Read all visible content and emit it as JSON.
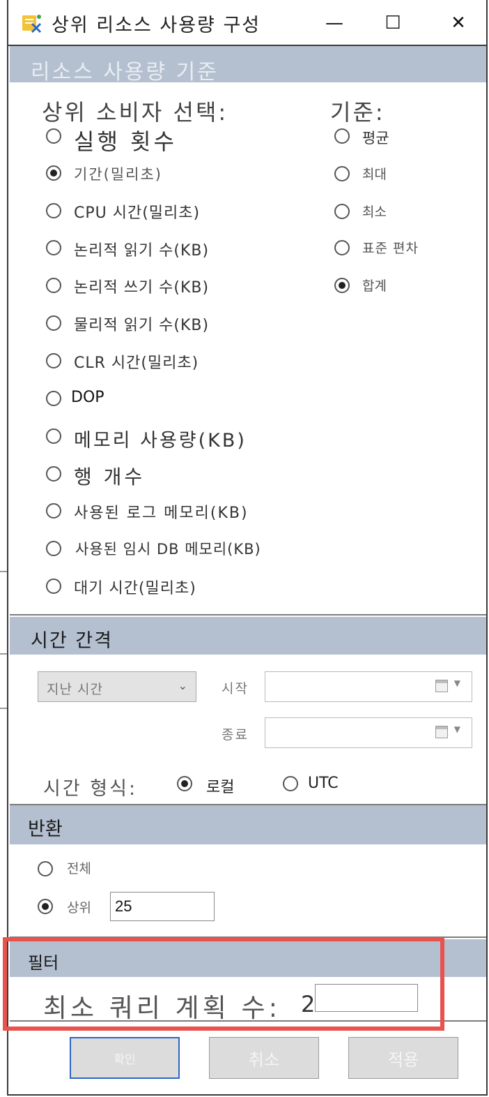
{
  "window": {
    "title": "상위 리소스 사용량 구성",
    "controls": {
      "minimize": "—",
      "maximize": "☐",
      "close": "✕"
    }
  },
  "resource_section": {
    "header": "리소스 사용량 기준",
    "consumer_label": "상위 소비자 선택:",
    "basis_label": "기준:",
    "consumers": [
      {
        "label": "실행 횟수",
        "checked": false
      },
      {
        "label": "기간(밀리초)",
        "checked": true
      },
      {
        "label": "CPU 시간(밀리초)",
        "checked": false
      },
      {
        "label": "논리적 읽기 수(KB)",
        "checked": false
      },
      {
        "label": "논리적 쓰기 수(KB)",
        "checked": false
      },
      {
        "label": "물리적 읽기 수(KB)",
        "checked": false
      },
      {
        "label": "CLR 시간(밀리초)",
        "checked": false
      },
      {
        "label": "DOP",
        "checked": false
      },
      {
        "label": "메모리 사용량(KB)",
        "checked": false
      },
      {
        "label": "행 개수",
        "checked": false
      },
      {
        "label": "사용된 로그 메모리(KB)",
        "checked": false
      },
      {
        "label": "사용된 임시 DB 메모리(KB)",
        "checked": false
      },
      {
        "label": "대기 시간(밀리초)",
        "checked": false
      }
    ],
    "basis": [
      {
        "label": "평균",
        "checked": false
      },
      {
        "label": "최대",
        "checked": false
      },
      {
        "label": "최소",
        "checked": false
      },
      {
        "label": "표준 편차",
        "checked": false
      },
      {
        "label": "합계",
        "checked": true
      }
    ]
  },
  "time_section": {
    "header": "시간 간격",
    "range_select": "지난 시간",
    "start_label": "시작",
    "end_label": "종료",
    "start_value": "",
    "end_value": "",
    "format_label": "시간 형식:",
    "formats": [
      {
        "label": "로컬",
        "checked": true
      },
      {
        "label": "UTC",
        "checked": false
      }
    ]
  },
  "return_section": {
    "header": "반환",
    "options": [
      {
        "label": "전체",
        "checked": false
      },
      {
        "label": "상위",
        "checked": true
      }
    ],
    "top_value": "25"
  },
  "filter_section": {
    "header": "필터",
    "min_plan_label": "최소 쿼리 계획 수:",
    "min_plan_value": "2"
  },
  "buttons": {
    "ok": "확인",
    "cancel": "취소",
    "apply": "적용"
  },
  "colors": {
    "section_header": "#b4c0d0",
    "highlight_border": "#e8534d",
    "default_button_border": "#2b67c6"
  }
}
